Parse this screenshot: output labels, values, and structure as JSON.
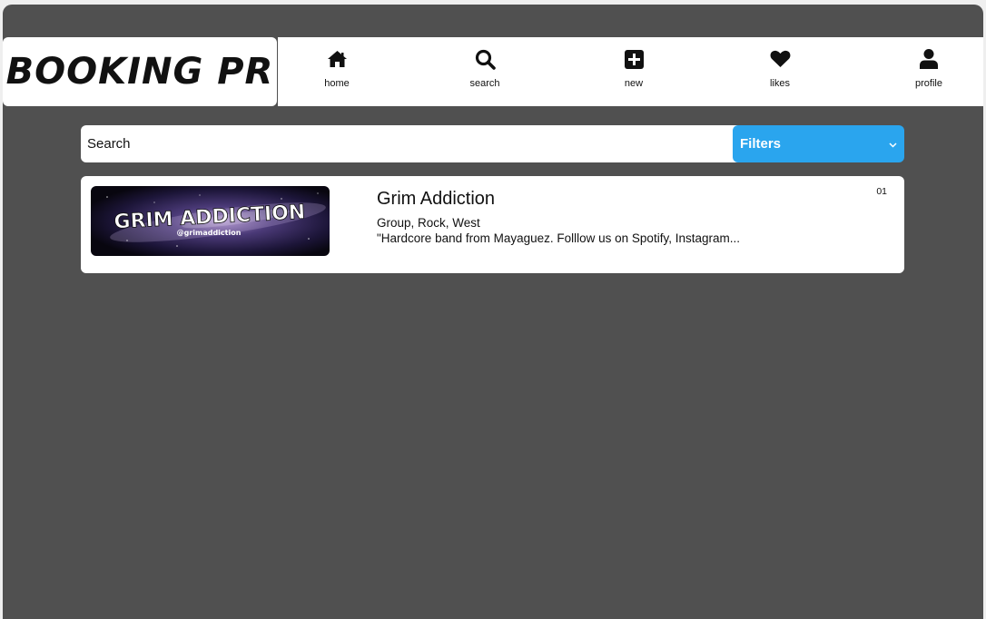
{
  "brand": {
    "logo_text": "BOOKING PR"
  },
  "nav": {
    "items": [
      {
        "label": "home",
        "icon": "home-icon"
      },
      {
        "label": "search",
        "icon": "search-icon"
      },
      {
        "label": "new",
        "icon": "plus-square-icon"
      },
      {
        "label": "likes",
        "icon": "heart-icon"
      },
      {
        "label": "profile",
        "icon": "user-icon"
      }
    ]
  },
  "search": {
    "placeholder": "Search",
    "value": ""
  },
  "filters": {
    "label": "Filters",
    "icon": "chevron-down-icon"
  },
  "results": [
    {
      "title": "Grim Addiction",
      "tags": "Group, Rock, West",
      "description": "\"Hardcore band from Mayaguez. Folllow us on Spotify, Instagram...",
      "index": "01",
      "image_text": "GRIM ADDICTION",
      "image_subtext": "@grimaddiction"
    }
  ],
  "colors": {
    "background": "#505050",
    "accent": "#2aa5ee",
    "surface": "#ffffff"
  }
}
